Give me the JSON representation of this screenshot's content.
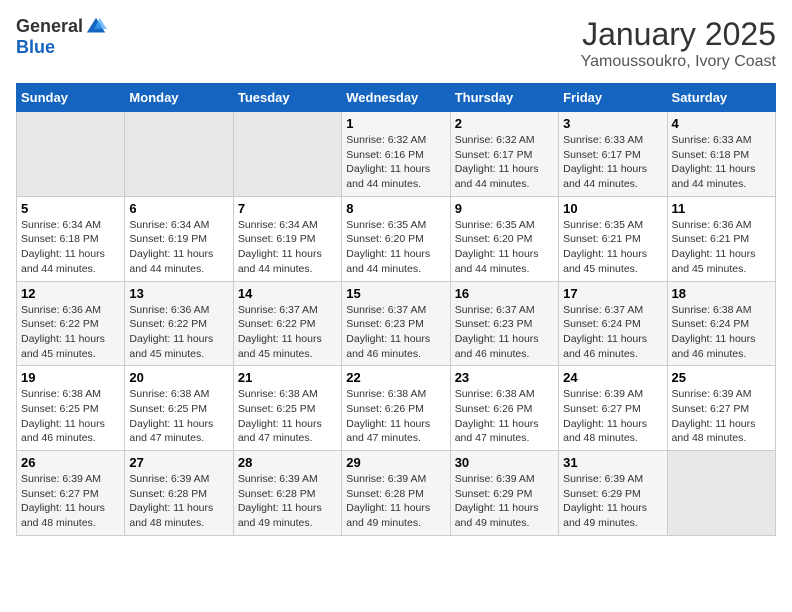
{
  "header": {
    "logo_general": "General",
    "logo_blue": "Blue",
    "title": "January 2025",
    "subtitle": "Yamoussoukro, Ivory Coast"
  },
  "days_of_week": [
    "Sunday",
    "Monday",
    "Tuesday",
    "Wednesday",
    "Thursday",
    "Friday",
    "Saturday"
  ],
  "weeks": [
    [
      {
        "day": "",
        "info": ""
      },
      {
        "day": "",
        "info": ""
      },
      {
        "day": "",
        "info": ""
      },
      {
        "day": "1",
        "info": "Sunrise: 6:32 AM\nSunset: 6:16 PM\nDaylight: 11 hours and 44 minutes."
      },
      {
        "day": "2",
        "info": "Sunrise: 6:32 AM\nSunset: 6:17 PM\nDaylight: 11 hours and 44 minutes."
      },
      {
        "day": "3",
        "info": "Sunrise: 6:33 AM\nSunset: 6:17 PM\nDaylight: 11 hours and 44 minutes."
      },
      {
        "day": "4",
        "info": "Sunrise: 6:33 AM\nSunset: 6:18 PM\nDaylight: 11 hours and 44 minutes."
      }
    ],
    [
      {
        "day": "5",
        "info": "Sunrise: 6:34 AM\nSunset: 6:18 PM\nDaylight: 11 hours and 44 minutes."
      },
      {
        "day": "6",
        "info": "Sunrise: 6:34 AM\nSunset: 6:19 PM\nDaylight: 11 hours and 44 minutes."
      },
      {
        "day": "7",
        "info": "Sunrise: 6:34 AM\nSunset: 6:19 PM\nDaylight: 11 hours and 44 minutes."
      },
      {
        "day": "8",
        "info": "Sunrise: 6:35 AM\nSunset: 6:20 PM\nDaylight: 11 hours and 44 minutes."
      },
      {
        "day": "9",
        "info": "Sunrise: 6:35 AM\nSunset: 6:20 PM\nDaylight: 11 hours and 44 minutes."
      },
      {
        "day": "10",
        "info": "Sunrise: 6:35 AM\nSunset: 6:21 PM\nDaylight: 11 hours and 45 minutes."
      },
      {
        "day": "11",
        "info": "Sunrise: 6:36 AM\nSunset: 6:21 PM\nDaylight: 11 hours and 45 minutes."
      }
    ],
    [
      {
        "day": "12",
        "info": "Sunrise: 6:36 AM\nSunset: 6:22 PM\nDaylight: 11 hours and 45 minutes."
      },
      {
        "day": "13",
        "info": "Sunrise: 6:36 AM\nSunset: 6:22 PM\nDaylight: 11 hours and 45 minutes."
      },
      {
        "day": "14",
        "info": "Sunrise: 6:37 AM\nSunset: 6:22 PM\nDaylight: 11 hours and 45 minutes."
      },
      {
        "day": "15",
        "info": "Sunrise: 6:37 AM\nSunset: 6:23 PM\nDaylight: 11 hours and 46 minutes."
      },
      {
        "day": "16",
        "info": "Sunrise: 6:37 AM\nSunset: 6:23 PM\nDaylight: 11 hours and 46 minutes."
      },
      {
        "day": "17",
        "info": "Sunrise: 6:37 AM\nSunset: 6:24 PM\nDaylight: 11 hours and 46 minutes."
      },
      {
        "day": "18",
        "info": "Sunrise: 6:38 AM\nSunset: 6:24 PM\nDaylight: 11 hours and 46 minutes."
      }
    ],
    [
      {
        "day": "19",
        "info": "Sunrise: 6:38 AM\nSunset: 6:25 PM\nDaylight: 11 hours and 46 minutes."
      },
      {
        "day": "20",
        "info": "Sunrise: 6:38 AM\nSunset: 6:25 PM\nDaylight: 11 hours and 47 minutes."
      },
      {
        "day": "21",
        "info": "Sunrise: 6:38 AM\nSunset: 6:25 PM\nDaylight: 11 hours and 47 minutes."
      },
      {
        "day": "22",
        "info": "Sunrise: 6:38 AM\nSunset: 6:26 PM\nDaylight: 11 hours and 47 minutes."
      },
      {
        "day": "23",
        "info": "Sunrise: 6:38 AM\nSunset: 6:26 PM\nDaylight: 11 hours and 47 minutes."
      },
      {
        "day": "24",
        "info": "Sunrise: 6:39 AM\nSunset: 6:27 PM\nDaylight: 11 hours and 48 minutes."
      },
      {
        "day": "25",
        "info": "Sunrise: 6:39 AM\nSunset: 6:27 PM\nDaylight: 11 hours and 48 minutes."
      }
    ],
    [
      {
        "day": "26",
        "info": "Sunrise: 6:39 AM\nSunset: 6:27 PM\nDaylight: 11 hours and 48 minutes."
      },
      {
        "day": "27",
        "info": "Sunrise: 6:39 AM\nSunset: 6:28 PM\nDaylight: 11 hours and 48 minutes."
      },
      {
        "day": "28",
        "info": "Sunrise: 6:39 AM\nSunset: 6:28 PM\nDaylight: 11 hours and 49 minutes."
      },
      {
        "day": "29",
        "info": "Sunrise: 6:39 AM\nSunset: 6:28 PM\nDaylight: 11 hours and 49 minutes."
      },
      {
        "day": "30",
        "info": "Sunrise: 6:39 AM\nSunset: 6:29 PM\nDaylight: 11 hours and 49 minutes."
      },
      {
        "day": "31",
        "info": "Sunrise: 6:39 AM\nSunset: 6:29 PM\nDaylight: 11 hours and 49 minutes."
      },
      {
        "day": "",
        "info": ""
      }
    ]
  ]
}
